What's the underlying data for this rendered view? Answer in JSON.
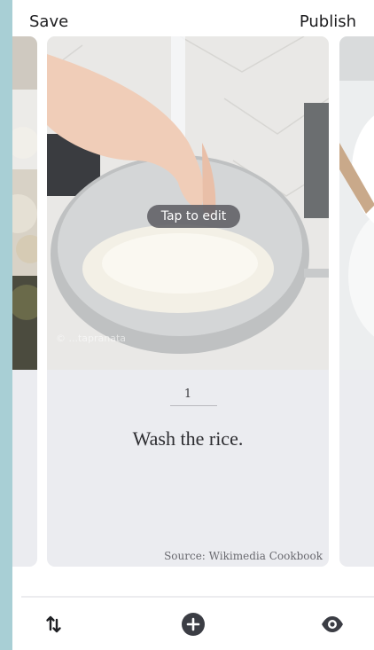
{
  "topbar": {
    "save_label": "Save",
    "publish_label": "Publish"
  },
  "card": {
    "tap_to_edit": "Tap to edit",
    "photo_credit": "© ...tapranata",
    "step_number": "1",
    "step_text": "Wash the rice.",
    "source": "Source: Wikimedia Cookbook"
  },
  "bottombar": {
    "reorder_icon": "reorder-arrows-icon",
    "add_icon": "add-circle-icon",
    "preview_icon": "eye-icon"
  },
  "colors": {
    "background": "#a8cfd5",
    "card": "#ebecf0",
    "icon": "#3b3d44"
  }
}
